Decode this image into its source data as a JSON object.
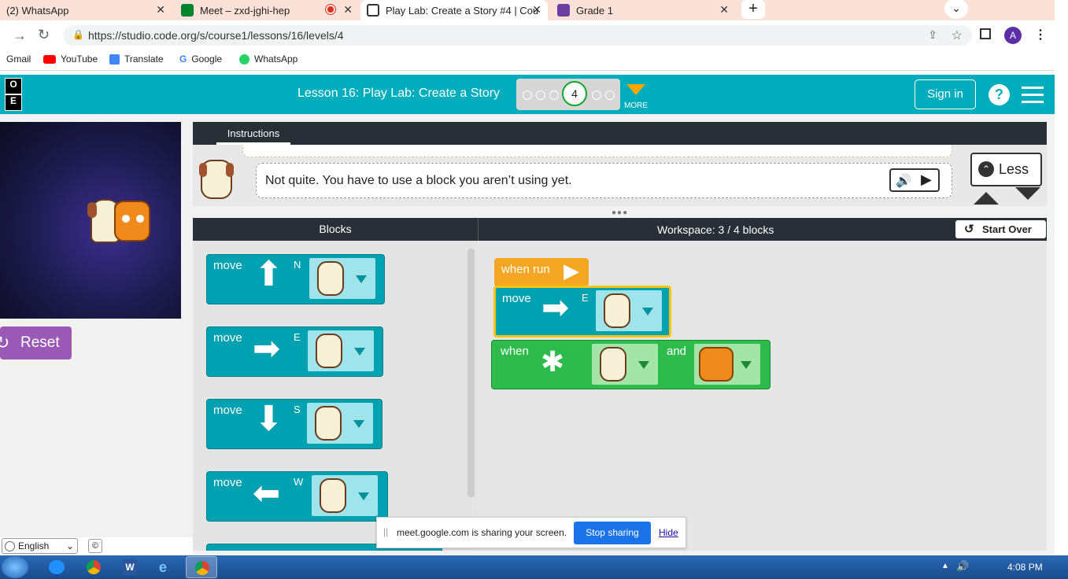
{
  "browser": {
    "tabs": [
      {
        "title": "(2) WhatsApp",
        "icon": "whatsapp-icon",
        "color": "#25d366"
      },
      {
        "title": "Meet – zxd-jghi-hep",
        "icon": "meet-icon",
        "color": "#00832d"
      },
      {
        "title": "Play Lab: Create a Story #4 | Cour",
        "icon": "codeorg-icon",
        "color": "#333333"
      },
      {
        "title": "Grade 1",
        "icon": "classroom-icon",
        "color": "#6b3fa0"
      }
    ],
    "url": "https://studio.code.org/s/course1/lessons/16/levels/4",
    "profile_initial": "A",
    "bookmarks": [
      {
        "label": "Gmail"
      },
      {
        "label": "YouTube"
      },
      {
        "label": "Translate"
      },
      {
        "label": "Google"
      },
      {
        "label": "WhatsApp"
      }
    ]
  },
  "header": {
    "logo": [
      "O",
      "E"
    ],
    "lesson_title": "Lesson 16: Play Lab: Create a Story",
    "current_level": "4",
    "more_label": "MORE",
    "sign_in": "Sign in",
    "help": "?"
  },
  "game": {
    "reset_label": "Reset"
  },
  "instructions": {
    "tab_label": "Instructions",
    "message": "Not quite. You have to use a block you aren’t using yet.",
    "less_label": "Less"
  },
  "blocks_panel": {
    "title": "Blocks",
    "items": [
      {
        "label": "move",
        "dir": "N"
      },
      {
        "label": "move",
        "dir": "E"
      },
      {
        "label": "move",
        "dir": "S"
      },
      {
        "label": "move",
        "dir": "W"
      }
    ]
  },
  "workspace": {
    "title": "Workspace: 3 / 4 blocks",
    "start_over": "Start Over",
    "when_run": "when run",
    "move_label": "move",
    "move_dir": "E",
    "when_label": "when",
    "and_label": "and"
  },
  "footer": {
    "language": "English"
  },
  "share_bar": {
    "message": "meet.google.com is sharing your screen.",
    "stop": "Stop sharing",
    "hide": "Hide"
  },
  "taskbar": {
    "time": "4:08 PM"
  }
}
